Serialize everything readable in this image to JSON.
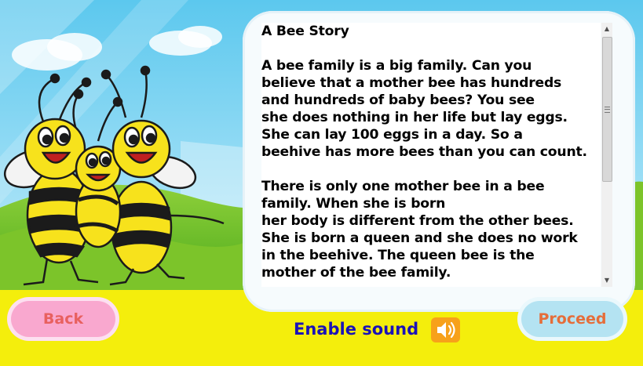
{
  "story": {
    "title": "A Bee Story",
    "paragraph1": "A bee family is a big family. Can you\nbelieve that a mother bee has hundreds\nand hundreds of baby bees? You see\nshe does nothing in her life but lay eggs.\nShe can lay 100 eggs in a day. So a\nbeehive has more bees than you can count.",
    "paragraph2": "There is only one mother bee in a bee\nfamily. When she is born\nher body is different from the other bees.\nShe is born a queen and she does no work\nin the beehive. The queen bee is the\nmother of the bee family."
  },
  "buttons": {
    "back_label": "Back",
    "proceed_label": "Proceed"
  },
  "sound": {
    "label": "Enable sound",
    "icon": "speaker-icon"
  },
  "colors": {
    "sky": "#8fd3ee",
    "grass": "#6fc22a",
    "bottom_bar": "#f4ee0c",
    "sound_label": "#1a12b8",
    "back_text": "#e8605f",
    "proceed_text": "#e56d3a",
    "sound_button": "#f7a11a"
  }
}
